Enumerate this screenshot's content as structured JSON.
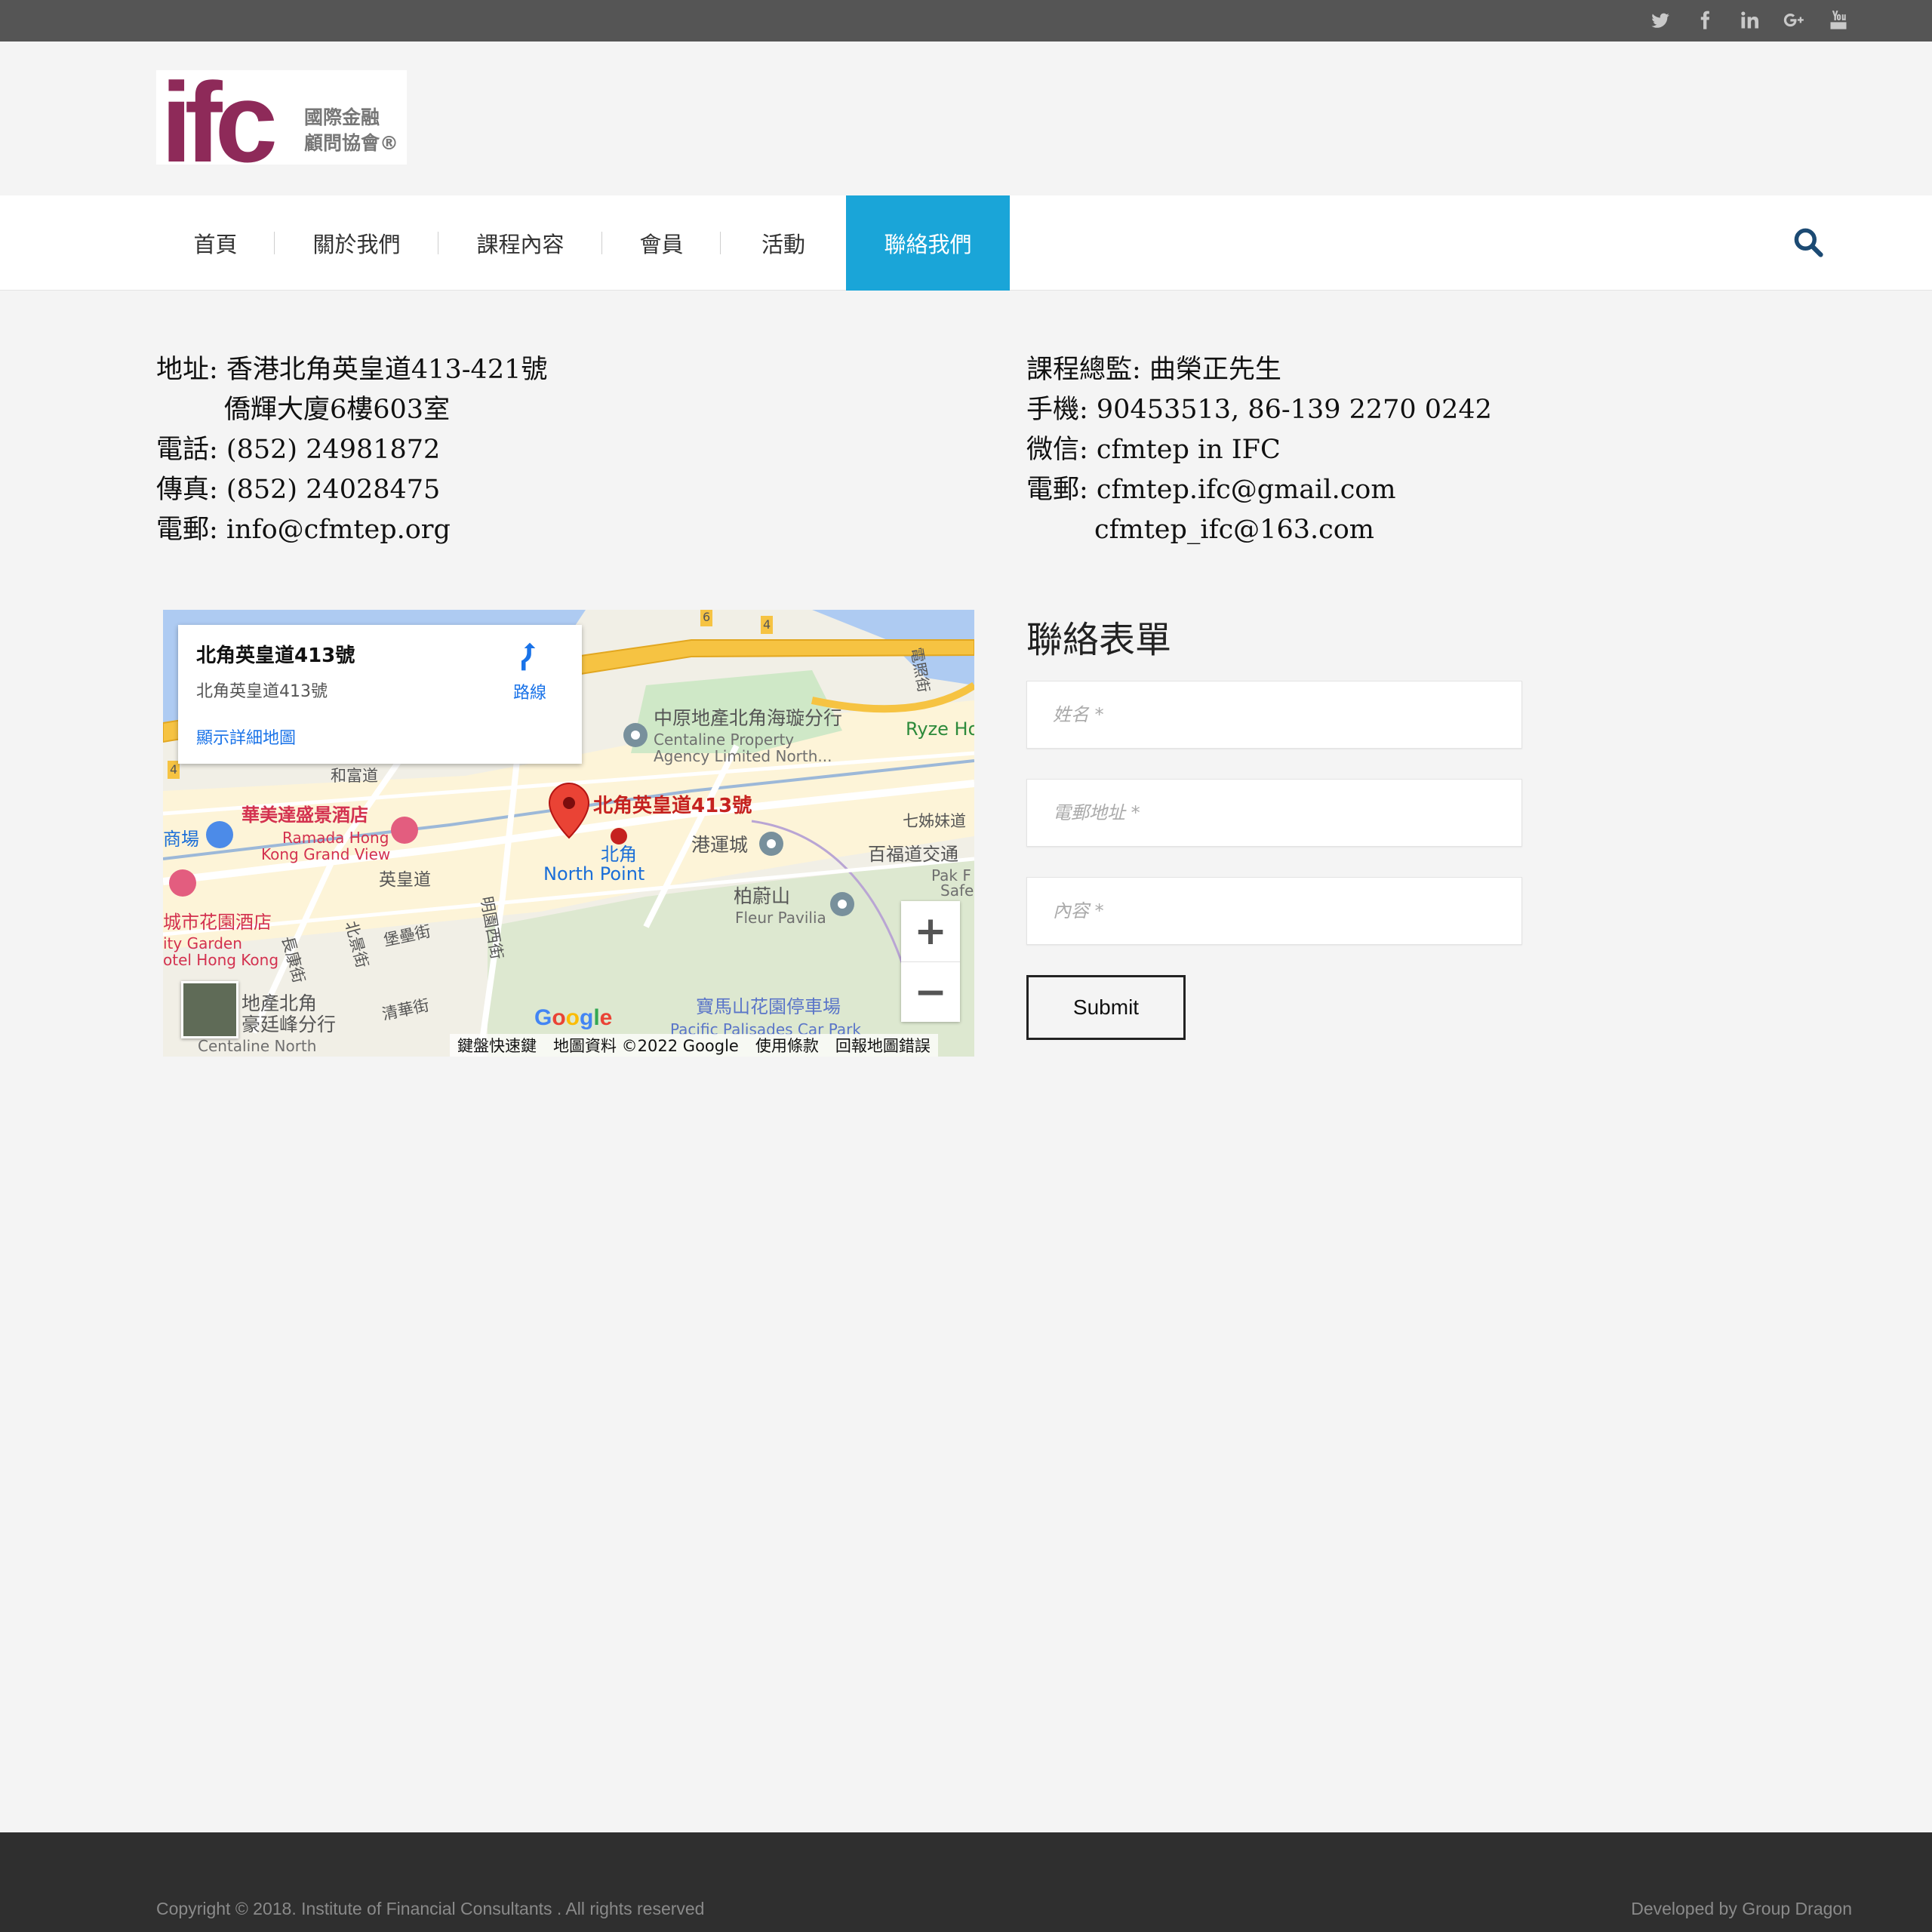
{
  "social": [
    {
      "name": "twitter-icon"
    },
    {
      "name": "facebook-icon"
    },
    {
      "name": "linkedin-icon"
    },
    {
      "name": "google-plus-icon"
    },
    {
      "name": "youtube-icon"
    }
  ],
  "logo": {
    "mark": "ifc",
    "line1": "國際金融",
    "line2": "顧問協會®"
  },
  "nav": {
    "items": [
      {
        "label": "首頁"
      },
      {
        "label": "關於我們"
      },
      {
        "label": "課程內容"
      },
      {
        "label": "會員"
      },
      {
        "label": "活動"
      },
      {
        "label": "聯絡我們",
        "active": true
      }
    ],
    "search_icon": "search-icon",
    "active_color": "#1aa5d8"
  },
  "contact_left": {
    "address_line1": "地址: 香港北角英皇道413-421號",
    "address_line2": "僑輝大廈6樓603室",
    "phone": "電話: (852) 24981872",
    "fax": "傳真: (852) 24028475",
    "email": "電郵: info@cfmtep.org"
  },
  "contact_right": {
    "director": "課程總監: 曲榮正先生",
    "mobile": "手機: 90453513, 86-139 2270 0242",
    "wechat": "微信: cfmtep in IFC",
    "email1": "電郵: cfmtep.ifc@gmail.com",
    "email2": "cfmtep_ifc@163.com"
  },
  "map": {
    "card_title": "北角英皇道413號",
    "card_address": "北角英皇道413號",
    "card_link": "顯示詳細地圖",
    "directions": "路線",
    "pin_label": "北角英皇道413號",
    "labels": {
      "centaline": "中原地產北角海璇分行",
      "centaline_en1": "Centaline Property",
      "centaline_en2": "Agency Limited North...",
      "ryze": "Ryze Ho",
      "wo_fung": "和富道",
      "ramada": "華美達盛景酒店",
      "ramada_en1": "Ramada Hong",
      "ramada_en2": "Kong Grand View",
      "mall": "商場",
      "north_point_cn": "北角",
      "north_point_en": "North Point",
      "harbour": "港運城",
      "seven_sisters": "七姊妹道",
      "pak_fuk": "百福道交通",
      "pak_f": "Pak F",
      "safe": "Safe",
      "kings_road": "英皇道",
      "fleur_cn": "柏蔚山",
      "fleur_en": "Fleur Pavilia",
      "city_garden": "城市花園酒店",
      "city_garden_en1": "ity Garden",
      "city_garden_en2": "otel Hong Kong",
      "ming_yuen": "明園西街",
      "north_view": "北景街",
      "fortress": "堡壘街",
      "chun_yeung": "長康街",
      "tsing_wah": "清華街",
      "centaline2_cn1": "地產北角",
      "centaline2_cn2": "豪廷峰分行",
      "centaline2_en": "Centaline North",
      "palisades_cn": "寶馬山花園停車場",
      "palisades_en": "Pacific Palisades Car Park",
      "tin_chiu": "電照街",
      "route_4a": "4",
      "route_4b": "4",
      "route_6": "6"
    },
    "google": "Google",
    "footer": [
      "鍵盤快速鍵",
      "地圖資料 ©2022 Google",
      "使用條款",
      "回報地圖錯誤"
    ],
    "zoom_in": "+",
    "zoom_out": "−"
  },
  "form": {
    "title": "聯絡表單",
    "name_placeholder": "姓名 *",
    "email_placeholder": "電郵地址 *",
    "content_placeholder": "內容 *",
    "submit": "Submit"
  },
  "footer": {
    "copyright": "Copyright © 2018. Institute of Financial Consultants . All rights reserved",
    "developer": "Developed by Group Dragon"
  }
}
